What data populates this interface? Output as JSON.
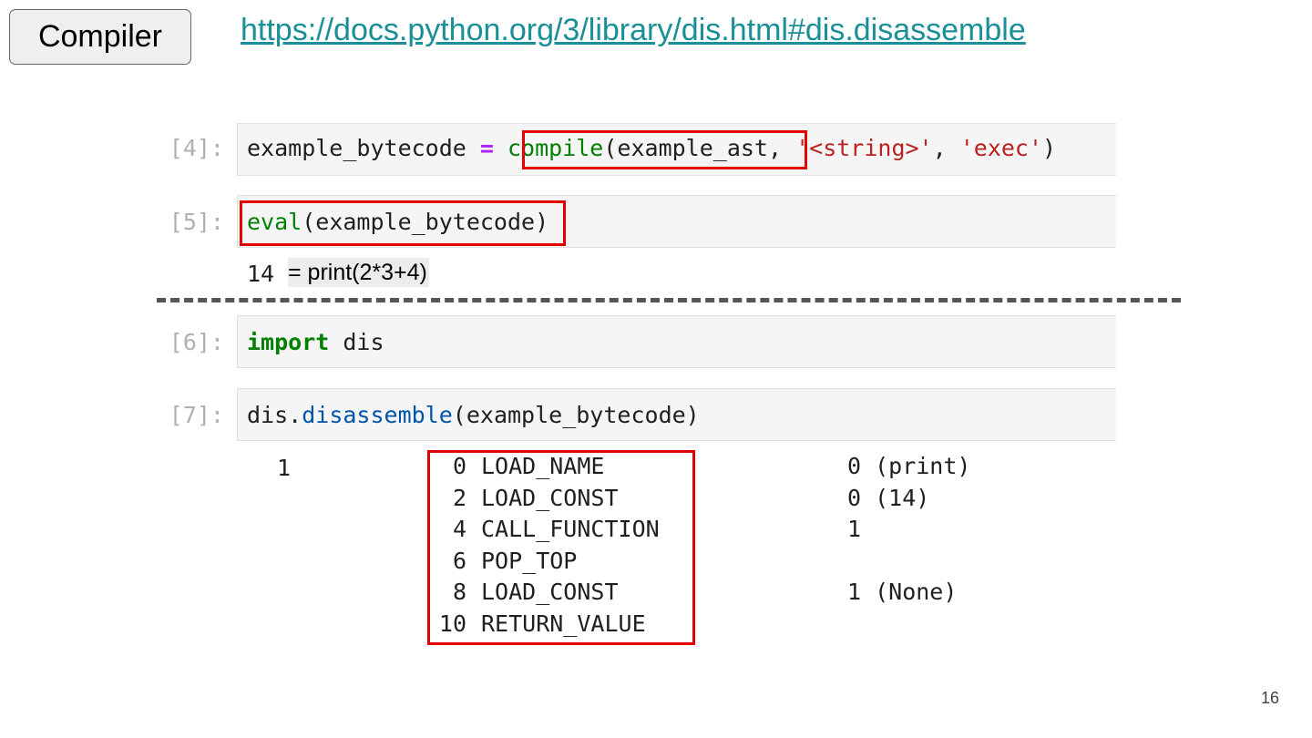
{
  "slide": {
    "tag_label": "Compiler",
    "doc_link": "https://docs.python.org/3/library/dis.html#dis.disassemble",
    "page_number": "16"
  },
  "cells": {
    "c4": {
      "prompt": "[4]:",
      "var": "example_bytecode ",
      "op": "=",
      "fn": "compile",
      "arg": "(example_ast",
      "sep1": ", ",
      "s1": "'<string>'",
      "sep2": ", ",
      "s2": "'exec'",
      "close": ")"
    },
    "c5": {
      "prompt": "[5]:",
      "fn": "eval",
      "arg": "(example_bytecode)",
      "output": "14",
      "note": "= print(2*3+4)"
    },
    "c6": {
      "prompt": "[6]:",
      "kw": "import",
      "mod": " dis"
    },
    "c7": {
      "prompt": "[7]:",
      "obj": "dis.",
      "attr": "disassemble",
      "arg": "(example_bytecode)"
    }
  },
  "disassembly": {
    "line_no": "1",
    "rows": [
      {
        "offset": "0",
        "opname": "LOAD_NAME",
        "arg": "0 (print)"
      },
      {
        "offset": "2",
        "opname": "LOAD_CONST",
        "arg": "0 (14)"
      },
      {
        "offset": "4",
        "opname": "CALL_FUNCTION",
        "arg": "1"
      },
      {
        "offset": "6",
        "opname": "POP_TOP",
        "arg": ""
      },
      {
        "offset": "8",
        "opname": "LOAD_CONST",
        "arg": "1 (None)"
      },
      {
        "offset": "10",
        "opname": "RETURN_VALUE",
        "arg": ""
      }
    ]
  },
  "colors": {
    "link": "#1a8f97",
    "highlight": "#e20000",
    "builtin": "#008000",
    "string": "#ba2121",
    "operator": "#aa22ff",
    "attribute": "#0055aa"
  }
}
